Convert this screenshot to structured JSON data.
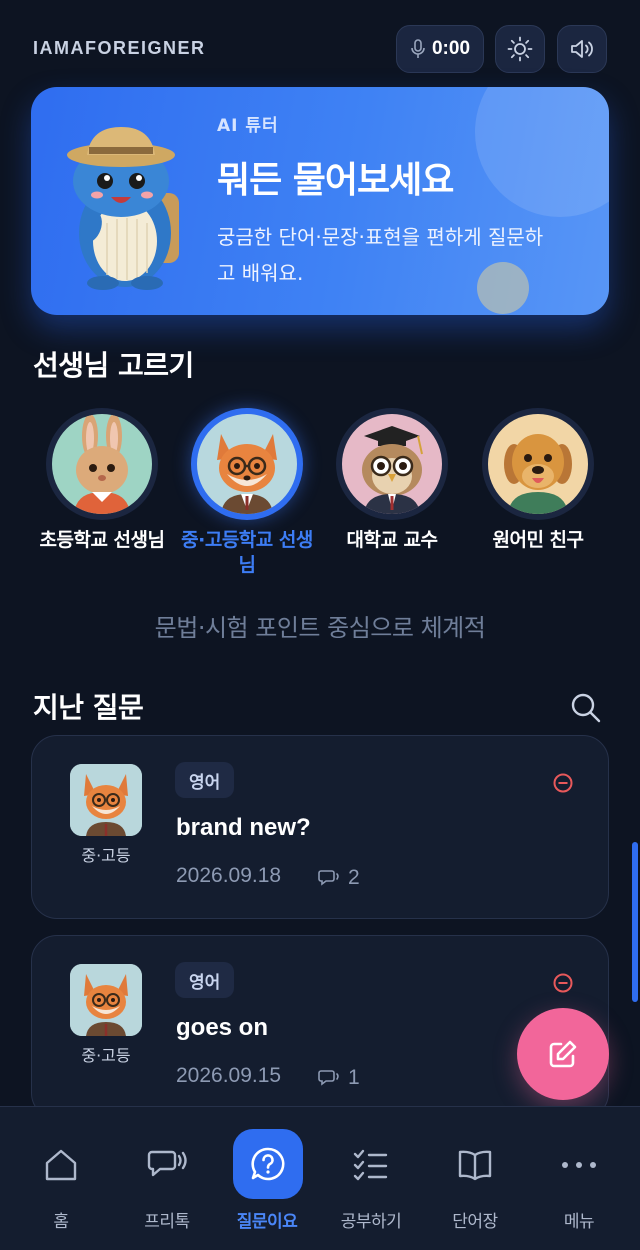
{
  "header": {
    "brand": "IAMAFOREIGNER",
    "timer": "0:00",
    "mic_icon": "mic-icon",
    "theme_icon": "sun-icon",
    "sound_icon": "speaker-icon"
  },
  "hero": {
    "kicker": "AI 튜터",
    "title": "뭐든 물어보세요",
    "description": "궁금한 단어·문장·표현을 편하게 질문하고 배워요.",
    "mascot": "whale-mascot"
  },
  "teachers": {
    "section_title": "선생님 고르기",
    "items": [
      {
        "label": "초등학교 선생님",
        "avatar": "rabbit-teacher",
        "selected": false
      },
      {
        "label": "중·고등학교 선생님",
        "avatar": "fox-teacher",
        "selected": true
      },
      {
        "label": "대학교 교수",
        "avatar": "owl-professor",
        "selected": false
      },
      {
        "label": "원어민 친구",
        "avatar": "dog-friend",
        "selected": false
      }
    ],
    "selected_description": "문법·시험 포인트 중심으로 체계적"
  },
  "history": {
    "section_title": "지난 질문",
    "items": [
      {
        "level": "중·고등",
        "language": "영어",
        "question": "brand new?",
        "date": "2026.09.18",
        "replies": "2"
      },
      {
        "level": "중·고등",
        "language": "영어",
        "question": "goes on",
        "date": "2026.09.15",
        "replies": "1"
      }
    ]
  },
  "nav": {
    "items": [
      {
        "label": "홈",
        "icon": "home-icon"
      },
      {
        "label": "프리톡",
        "icon": "chat-icon"
      },
      {
        "label": "질문이요",
        "icon": "question-icon",
        "active": true
      },
      {
        "label": "공부하기",
        "icon": "checklist-icon"
      },
      {
        "label": "단어장",
        "icon": "book-icon"
      },
      {
        "label": "메뉴",
        "icon": "more-icon"
      }
    ]
  },
  "colors": {
    "background": "#0d1422",
    "accent": "#2f6df0",
    "fab": "#f2669a",
    "danger": "#e8595b"
  }
}
